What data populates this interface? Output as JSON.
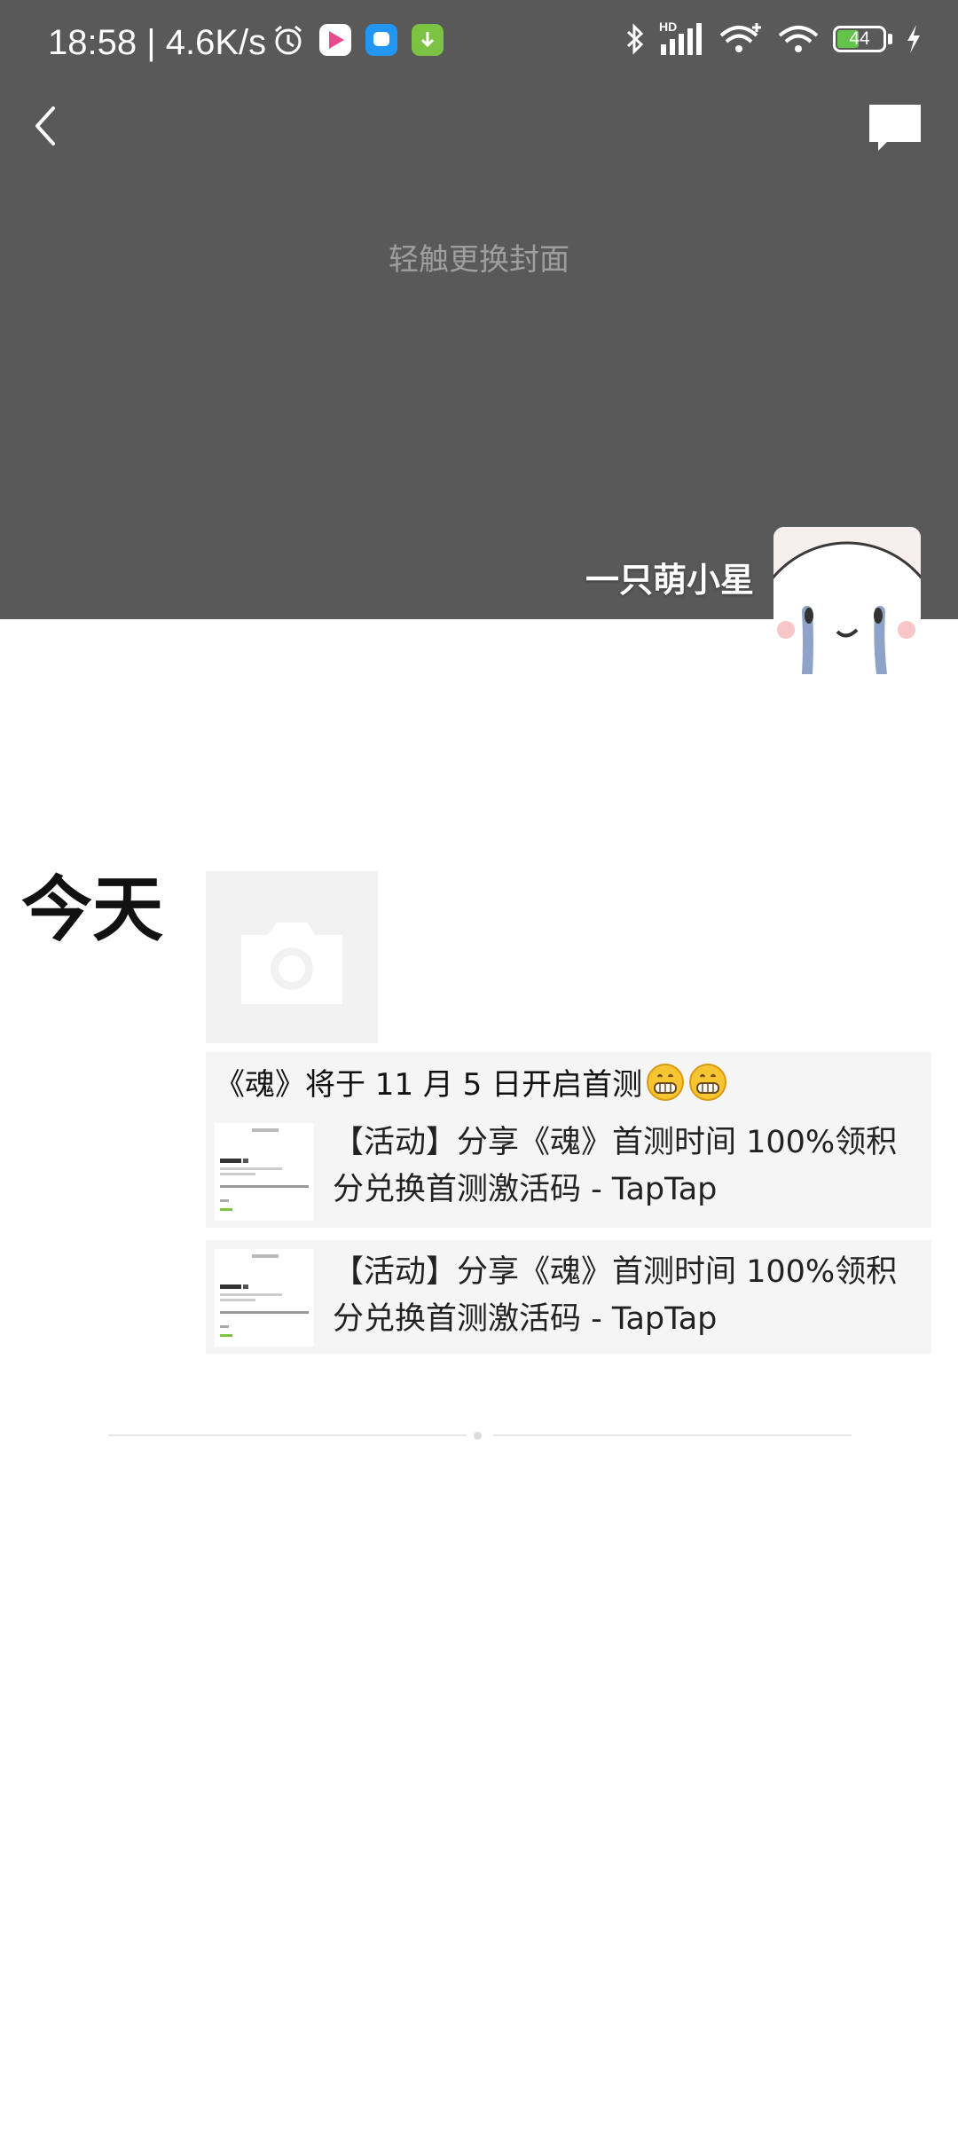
{
  "status_bar": {
    "time_speed": "18:58 | 4.6K/s",
    "network_label": "HD",
    "battery_level": "44"
  },
  "cover": {
    "hint": "轻触更换封面",
    "username": "一只萌小星"
  },
  "timeline": {
    "date_label": "今天",
    "post": {
      "text": "《魂》将于 11 月 5 日开启首测",
      "emoji": "grinning-face-emoji",
      "shares": [
        {
          "title": "【活动】分享《魂》首测时间 100%领积分兑换首测激活码 - TapTap"
        },
        {
          "title": "【活动】分享《魂》首测时间 100%领积分兑换首测激活码 - TapTap"
        }
      ]
    }
  },
  "colors": {
    "cover_bg": "#595959",
    "card_bg": "#f5f5f5",
    "battery_fill": "#63c34b"
  }
}
